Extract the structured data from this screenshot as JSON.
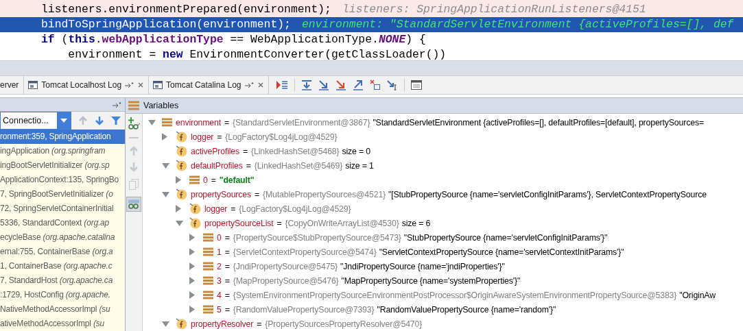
{
  "code": {
    "lines": [
      {
        "breakpoint": true,
        "selected": false,
        "tokens": [
          {
            "text": "listeners.environmentPrepared(environment);",
            "kind": "plain"
          }
        ],
        "hint": "listeners: SpringApplicationRunListeners@4151"
      },
      {
        "breakpoint": false,
        "selected": true,
        "tokens": [
          {
            "text": "bindToSpringApplication(environment);",
            "kind": "plain"
          }
        ],
        "hint": "environment: \"StandardServletEnvironment {activeProfiles=[], def"
      },
      {
        "breakpoint": false,
        "selected": false,
        "tokens": [
          {
            "text": "if",
            "kind": "keyword"
          },
          {
            "text": " (",
            "kind": "plain"
          },
          {
            "text": "this",
            "kind": "keyword"
          },
          {
            "text": ".",
            "kind": "plain"
          },
          {
            "text": "webApplicationType",
            "kind": "field"
          },
          {
            "text": " == WebApplicationType.",
            "kind": "plain"
          },
          {
            "text": "NONE",
            "kind": "constant"
          },
          {
            "text": ") {",
            "kind": "plain"
          }
        ]
      },
      {
        "breakpoint": false,
        "selected": false,
        "tokens": [
          {
            "text": "    environment = ",
            "kind": "plain"
          },
          {
            "text": "new",
            "kind": "keyword"
          },
          {
            "text": " EnvironmentConverter(getClassLoader())",
            "kind": "plain"
          }
        ]
      }
    ]
  },
  "tabs": [
    {
      "label": "erver",
      "selected": false,
      "icon": false
    },
    {
      "label": "Tomcat Localhost Log",
      "selected": false,
      "icon": true
    },
    {
      "label": "Tomcat Catalina Log",
      "selected": false,
      "icon": true
    }
  ],
  "frames": {
    "thread": "Connectio...",
    "items": [
      {
        "text": "ronment:359, SpringApplication",
        "selected": true
      },
      {
        "text": "ingApplication *(org.springfram*",
        "selected": false
      },
      {
        "text": "ingBootServletInitializer *(org.sp*",
        "selected": false
      },
      {
        "text": "ApplicationContext:135, SpringBo",
        "selected": false
      },
      {
        "text": "7, SpringBootServletInitializer *(o*",
        "selected": false
      },
      {
        "text": "72, SpringServletContainerInitial",
        "selected": false
      },
      {
        "text": "5336, StandardContext *(org.ap*",
        "selected": false
      },
      {
        "text": "ecycleBase *(org.apache.catalina*",
        "selected": false
      },
      {
        "text": "ernal:755, ContainerBase *(org.a*",
        "selected": false
      },
      {
        "text": "1, ContainerBase *(org.apache.c*",
        "selected": false
      },
      {
        "text": "7, StandardHost *(org.apache.ca*",
        "selected": false
      },
      {
        "text": ":1729, HostConfig *(org.apache.*",
        "selected": false
      },
      {
        "text": "NativeMethodAccessorImpl *(su*",
        "selected": false
      },
      {
        "text": "ativeMethodAccessorImpl *(su*",
        "selected": false
      }
    ]
  },
  "variables": {
    "title": "Variables",
    "tree": [
      {
        "kind": "object",
        "expandable": true,
        "expanded": true,
        "name": "environment",
        "equals": "=",
        "type": "{StandardServletEnvironment@3867}",
        "value": "\"StandardServletEnvironment {activeProfiles=[], defaultProfiles=[default], propertySources=",
        "string": false,
        "children": [
          {
            "kind": "field",
            "expandable": true,
            "expanded": false,
            "name": "logger",
            "equals": "=",
            "type": "{LogFactory$Log4jLog@4529}"
          },
          {
            "kind": "field",
            "expandable": false,
            "name": "activeProfiles",
            "equals": "=",
            "type": "{LinkedHashSet@5468}",
            "value": "size = 0",
            "string": false
          },
          {
            "kind": "field",
            "expandable": true,
            "expanded": true,
            "name": "defaultProfiles",
            "equals": "=",
            "type": "{LinkedHashSet@5469}",
            "value": "size = 1",
            "string": false,
            "children": [
              {
                "kind": "object",
                "expandable": true,
                "expanded": false,
                "name": "0",
                "equals": "=",
                "value": "\"default\"",
                "string": true
              }
            ]
          },
          {
            "kind": "field",
            "expandable": true,
            "expanded": true,
            "name": "propertySources",
            "equals": "=",
            "type": "{MutablePropertySources@4521}",
            "value": "\"[StubPropertySource {name='servletConfigInitParams'}, ServletContextPropertySource",
            "string": false,
            "children": [
              {
                "kind": "field",
                "expandable": true,
                "expanded": false,
                "name": "logger",
                "equals": "=",
                "type": "{LogFactory$Log4jLog@4529}"
              },
              {
                "kind": "field",
                "expandable": true,
                "expanded": true,
                "name": "propertySourceList",
                "equals": "=",
                "type": "{CopyOnWriteArrayList@4530}",
                "value": "size = 6",
                "string": false,
                "children": [
                  {
                    "kind": "object",
                    "expandable": true,
                    "expanded": false,
                    "name": "0",
                    "equals": "=",
                    "type": "{PropertySource$StubPropertySource@5473}",
                    "value": "\"StubPropertySource {name='servletConfigInitParams'}\"",
                    "string": false
                  },
                  {
                    "kind": "object",
                    "expandable": true,
                    "expanded": false,
                    "name": "1",
                    "equals": "=",
                    "type": "{ServletContextPropertySource@5474}",
                    "value": "\"ServletContextPropertySource {name='servletContextInitParams'}\"",
                    "string": false
                  },
                  {
                    "kind": "object",
                    "expandable": true,
                    "expanded": false,
                    "name": "2",
                    "equals": "=",
                    "type": "{JndiPropertySource@5475}",
                    "value": "\"JndiPropertySource {name='jndiProperties'}\"",
                    "string": false
                  },
                  {
                    "kind": "object",
                    "expandable": true,
                    "expanded": false,
                    "name": "3",
                    "equals": "=",
                    "type": "{MapPropertySource@5476}",
                    "value": "\"MapPropertySource {name='systemProperties'}\"",
                    "string": false
                  },
                  {
                    "kind": "object",
                    "expandable": true,
                    "expanded": false,
                    "name": "4",
                    "equals": "=",
                    "type": "{SystemEnvironmentPropertySourceEnvironmentPostProcessor$OriginAwareSystemEnvironmentPropertySource@5383}",
                    "value": "\"OriginAw",
                    "string": false
                  },
                  {
                    "kind": "object",
                    "expandable": true,
                    "expanded": false,
                    "name": "5",
                    "equals": "=",
                    "type": "{RandomValuePropertySource@7393}",
                    "value": "\"RandomValuePropertySource {name='random'}\"",
                    "string": false
                  }
                ]
              }
            ]
          },
          {
            "kind": "field",
            "expandable": true,
            "expanded": true,
            "name": "propertyResolver",
            "equals": "=",
            "type": "{PropertySourcesPropertyResolver@5470}"
          }
        ]
      }
    ]
  }
}
